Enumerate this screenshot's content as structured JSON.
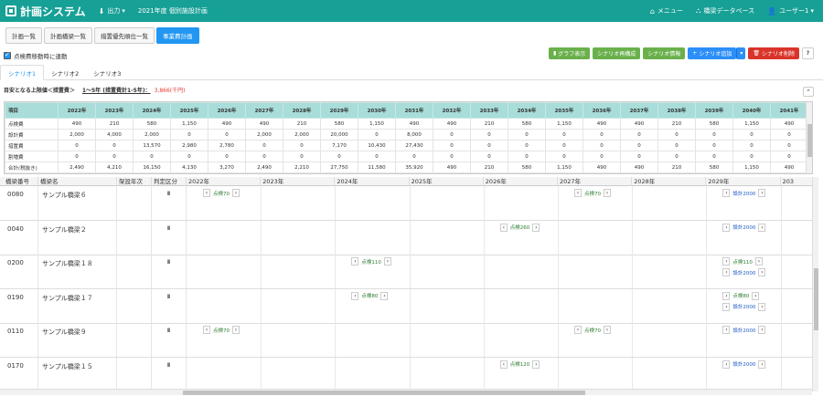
{
  "nav": {
    "brand": "計画システム",
    "output": "出力",
    "plan_title": "2021年度 個別施設計画",
    "menu": "メニュー",
    "bridge_db": "橋梁データベース",
    "user": "ユーザー1"
  },
  "page_tabs": [
    "計画一覧",
    "計画橋梁一覧",
    "措置優先順位一覧",
    "事業費計画"
  ],
  "checkbox_label": "点検費移動時に連動",
  "buttons": {
    "graph": "グラフ表示",
    "rebuild": "シナリオ再構成",
    "info": "シナリオ情報",
    "add": "シナリオ追加",
    "delete": "シナリオ削除",
    "help": "?"
  },
  "scenario_tabs": [
    "シナリオ1",
    "シナリオ2",
    "シナリオ3"
  ],
  "budget": {
    "label": "目安となる上限値＜措置費＞",
    "range": "1～5年 (措置費計1-5年)：",
    "value": "3,866(千円)"
  },
  "summary": {
    "header_label": "項目",
    "years": [
      "2022年",
      "2023年",
      "2024年",
      "2025年",
      "2026年",
      "2027年",
      "2028年",
      "2029年",
      "2030年",
      "2031年",
      "2032年",
      "2033年",
      "2034年",
      "2035年",
      "2036年",
      "2037年",
      "2038年",
      "2039年",
      "2040年",
      "2041年"
    ],
    "rows": [
      {
        "label": "点検費",
        "values": [
          "490",
          "210",
          "580",
          "1,150",
          "490",
          "490",
          "210",
          "580",
          "1,150",
          "490",
          "490",
          "210",
          "580",
          "1,150",
          "490",
          "490",
          "210",
          "580",
          "1,150",
          "490"
        ]
      },
      {
        "label": "設計費",
        "values": [
          "2,000",
          "4,000",
          "2,000",
          "0",
          "0",
          "2,000",
          "2,000",
          "20,000",
          "0",
          "8,000",
          "0",
          "0",
          "0",
          "0",
          "0",
          "0",
          "0",
          "0",
          "0",
          "0"
        ]
      },
      {
        "label": "措置費",
        "values": [
          "0",
          "0",
          "13,570",
          "2,980",
          "2,780",
          "0",
          "0",
          "7,170",
          "10,430",
          "27,430",
          "0",
          "0",
          "0",
          "0",
          "0",
          "0",
          "0",
          "0",
          "0",
          "0"
        ]
      },
      {
        "label": "割増費",
        "values": [
          "0",
          "0",
          "0",
          "0",
          "0",
          "0",
          "0",
          "0",
          "0",
          "0",
          "0",
          "0",
          "0",
          "0",
          "0",
          "0",
          "0",
          "0",
          "0",
          "0"
        ]
      },
      {
        "label": "合計(税抜き)",
        "values": [
          "2,490",
          "4,210",
          "16,150",
          "4,130",
          "3,270",
          "2,490",
          "2,210",
          "27,750",
          "11,580",
          "35,920",
          "490",
          "210",
          "580",
          "1,150",
          "490",
          "490",
          "210",
          "580",
          "1,150",
          "490"
        ]
      }
    ]
  },
  "grid": {
    "headers": {
      "id": "橋梁番号",
      "name": "橋梁名",
      "built": "架設年次",
      "judge": "判定区分"
    },
    "years": [
      "2022年",
      "2023年",
      "2024年",
      "2025年",
      "2026年",
      "2027年",
      "2028年",
      "2029年",
      "203"
    ],
    "rows": [
      {
        "id": "0080",
        "name": "サンプル橋梁６",
        "judge": "Ⅲ"
      },
      {
        "id": "0040",
        "name": "サンプル橋梁２",
        "judge": "Ⅲ"
      },
      {
        "id": "0200",
        "name": "サンプル橋梁１８",
        "judge": "Ⅲ"
      },
      {
        "id": "0190",
        "name": "サンプル橋梁１７",
        "judge": "Ⅲ"
      },
      {
        "id": "0110",
        "name": "サンプル橋梁９",
        "judge": "Ⅲ"
      },
      {
        "id": "0170",
        "name": "サンプル橋梁１５",
        "judge": "Ⅲ"
      }
    ],
    "chips": [
      {
        "row": 0,
        "year": 0,
        "type": "g",
        "label": "点検70"
      },
      {
        "row": 0,
        "year": 5,
        "type": "g",
        "label": "点検70"
      },
      {
        "row": 0,
        "year": 7,
        "type": "b",
        "label": "設計2000"
      },
      {
        "row": 1,
        "year": 4,
        "type": "g",
        "label": "点検260"
      },
      {
        "row": 1,
        "year": 7,
        "type": "b",
        "label": "設計2000"
      },
      {
        "row": 2,
        "year": 2,
        "type": "g",
        "label": "点検110"
      },
      {
        "row": 2,
        "year": 7,
        "type": "g",
        "label": "点検110"
      },
      {
        "row": 2,
        "year": 7,
        "type": "b",
        "label": "設計2000",
        "second": true
      },
      {
        "row": 3,
        "year": 2,
        "type": "g",
        "label": "点検80"
      },
      {
        "row": 3,
        "year": 7,
        "type": "g",
        "label": "点検80"
      },
      {
        "row": 3,
        "year": 7,
        "type": "b",
        "label": "設計2000",
        "second": true
      },
      {
        "row": 4,
        "year": 0,
        "type": "g",
        "label": "点検70"
      },
      {
        "row": 4,
        "year": 5,
        "type": "g",
        "label": "点検70"
      },
      {
        "row": 4,
        "year": 7,
        "type": "b",
        "label": "設計2000"
      },
      {
        "row": 5,
        "year": 4,
        "type": "g",
        "label": "点検120"
      },
      {
        "row": 5,
        "year": 7,
        "type": "b",
        "label": "設計2000"
      }
    ]
  }
}
